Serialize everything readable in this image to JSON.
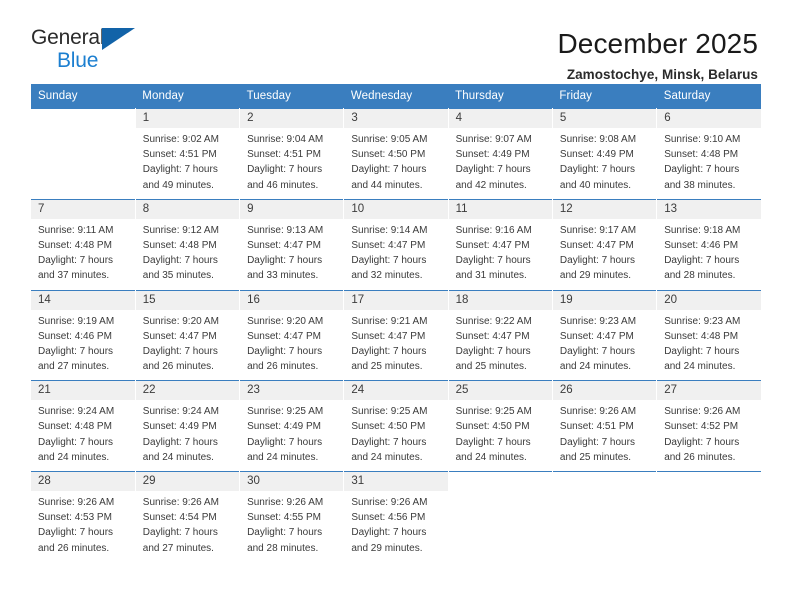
{
  "brand": {
    "name_part1": "General",
    "name_part2": "Blue",
    "accent_color": "#1c7fd0",
    "triangle_color": "#1263a8",
    "logo_icon": "triangle-icon"
  },
  "header": {
    "title": "December 2025",
    "subtitle": "Zamostochye, Minsk, Belarus"
  },
  "theme": {
    "header_row_bg": "#3a7ebf",
    "header_row_text": "#ffffff",
    "date_band_bg": "#f0f0f0",
    "cell_bg": "#ffffff",
    "text_color": "#3a3a3a"
  },
  "weekday_headers": [
    "Sunday",
    "Monday",
    "Tuesday",
    "Wednesday",
    "Thursday",
    "Friday",
    "Saturday"
  ],
  "labels": {
    "sunrise_prefix": "Sunrise:",
    "sunset_prefix": "Sunset:",
    "daylight_prefix": "Daylight:"
  },
  "weeks": [
    [
      {
        "date": "",
        "lines": []
      },
      {
        "date": "1",
        "lines": [
          "Sunrise: 9:02 AM",
          "Sunset: 4:51 PM",
          "Daylight: 7 hours",
          "and 49 minutes."
        ]
      },
      {
        "date": "2",
        "lines": [
          "Sunrise: 9:04 AM",
          "Sunset: 4:51 PM",
          "Daylight: 7 hours",
          "and 46 minutes."
        ]
      },
      {
        "date": "3",
        "lines": [
          "Sunrise: 9:05 AM",
          "Sunset: 4:50 PM",
          "Daylight: 7 hours",
          "and 44 minutes."
        ]
      },
      {
        "date": "4",
        "lines": [
          "Sunrise: 9:07 AM",
          "Sunset: 4:49 PM",
          "Daylight: 7 hours",
          "and 42 minutes."
        ]
      },
      {
        "date": "5",
        "lines": [
          "Sunrise: 9:08 AM",
          "Sunset: 4:49 PM",
          "Daylight: 7 hours",
          "and 40 minutes."
        ]
      },
      {
        "date": "6",
        "lines": [
          "Sunrise: 9:10 AM",
          "Sunset: 4:48 PM",
          "Daylight: 7 hours",
          "and 38 minutes."
        ]
      }
    ],
    [
      {
        "date": "7",
        "lines": [
          "Sunrise: 9:11 AM",
          "Sunset: 4:48 PM",
          "Daylight: 7 hours",
          "and 37 minutes."
        ]
      },
      {
        "date": "8",
        "lines": [
          "Sunrise: 9:12 AM",
          "Sunset: 4:48 PM",
          "Daylight: 7 hours",
          "and 35 minutes."
        ]
      },
      {
        "date": "9",
        "lines": [
          "Sunrise: 9:13 AM",
          "Sunset: 4:47 PM",
          "Daylight: 7 hours",
          "and 33 minutes."
        ]
      },
      {
        "date": "10",
        "lines": [
          "Sunrise: 9:14 AM",
          "Sunset: 4:47 PM",
          "Daylight: 7 hours",
          "and 32 minutes."
        ]
      },
      {
        "date": "11",
        "lines": [
          "Sunrise: 9:16 AM",
          "Sunset: 4:47 PM",
          "Daylight: 7 hours",
          "and 31 minutes."
        ]
      },
      {
        "date": "12",
        "lines": [
          "Sunrise: 9:17 AM",
          "Sunset: 4:47 PM",
          "Daylight: 7 hours",
          "and 29 minutes."
        ]
      },
      {
        "date": "13",
        "lines": [
          "Sunrise: 9:18 AM",
          "Sunset: 4:46 PM",
          "Daylight: 7 hours",
          "and 28 minutes."
        ]
      }
    ],
    [
      {
        "date": "14",
        "lines": [
          "Sunrise: 9:19 AM",
          "Sunset: 4:46 PM",
          "Daylight: 7 hours",
          "and 27 minutes."
        ]
      },
      {
        "date": "15",
        "lines": [
          "Sunrise: 9:20 AM",
          "Sunset: 4:47 PM",
          "Daylight: 7 hours",
          "and 26 minutes."
        ]
      },
      {
        "date": "16",
        "lines": [
          "Sunrise: 9:20 AM",
          "Sunset: 4:47 PM",
          "Daylight: 7 hours",
          "and 26 minutes."
        ]
      },
      {
        "date": "17",
        "lines": [
          "Sunrise: 9:21 AM",
          "Sunset: 4:47 PM",
          "Daylight: 7 hours",
          "and 25 minutes."
        ]
      },
      {
        "date": "18",
        "lines": [
          "Sunrise: 9:22 AM",
          "Sunset: 4:47 PM",
          "Daylight: 7 hours",
          "and 25 minutes."
        ]
      },
      {
        "date": "19",
        "lines": [
          "Sunrise: 9:23 AM",
          "Sunset: 4:47 PM",
          "Daylight: 7 hours",
          "and 24 minutes."
        ]
      },
      {
        "date": "20",
        "lines": [
          "Sunrise: 9:23 AM",
          "Sunset: 4:48 PM",
          "Daylight: 7 hours",
          "and 24 minutes."
        ]
      }
    ],
    [
      {
        "date": "21",
        "lines": [
          "Sunrise: 9:24 AM",
          "Sunset: 4:48 PM",
          "Daylight: 7 hours",
          "and 24 minutes."
        ]
      },
      {
        "date": "22",
        "lines": [
          "Sunrise: 9:24 AM",
          "Sunset: 4:49 PM",
          "Daylight: 7 hours",
          "and 24 minutes."
        ]
      },
      {
        "date": "23",
        "lines": [
          "Sunrise: 9:25 AM",
          "Sunset: 4:49 PM",
          "Daylight: 7 hours",
          "and 24 minutes."
        ]
      },
      {
        "date": "24",
        "lines": [
          "Sunrise: 9:25 AM",
          "Sunset: 4:50 PM",
          "Daylight: 7 hours",
          "and 24 minutes."
        ]
      },
      {
        "date": "25",
        "lines": [
          "Sunrise: 9:25 AM",
          "Sunset: 4:50 PM",
          "Daylight: 7 hours",
          "and 24 minutes."
        ]
      },
      {
        "date": "26",
        "lines": [
          "Sunrise: 9:26 AM",
          "Sunset: 4:51 PM",
          "Daylight: 7 hours",
          "and 25 minutes."
        ]
      },
      {
        "date": "27",
        "lines": [
          "Sunrise: 9:26 AM",
          "Sunset: 4:52 PM",
          "Daylight: 7 hours",
          "and 26 minutes."
        ]
      }
    ],
    [
      {
        "date": "28",
        "lines": [
          "Sunrise: 9:26 AM",
          "Sunset: 4:53 PM",
          "Daylight: 7 hours",
          "and 26 minutes."
        ]
      },
      {
        "date": "29",
        "lines": [
          "Sunrise: 9:26 AM",
          "Sunset: 4:54 PM",
          "Daylight: 7 hours",
          "and 27 minutes."
        ]
      },
      {
        "date": "30",
        "lines": [
          "Sunrise: 9:26 AM",
          "Sunset: 4:55 PM",
          "Daylight: 7 hours",
          "and 28 minutes."
        ]
      },
      {
        "date": "31",
        "lines": [
          "Sunrise: 9:26 AM",
          "Sunset: 4:56 PM",
          "Daylight: 7 hours",
          "and 29 minutes."
        ]
      },
      {
        "date": "",
        "lines": []
      },
      {
        "date": "",
        "lines": []
      },
      {
        "date": "",
        "lines": []
      }
    ]
  ]
}
